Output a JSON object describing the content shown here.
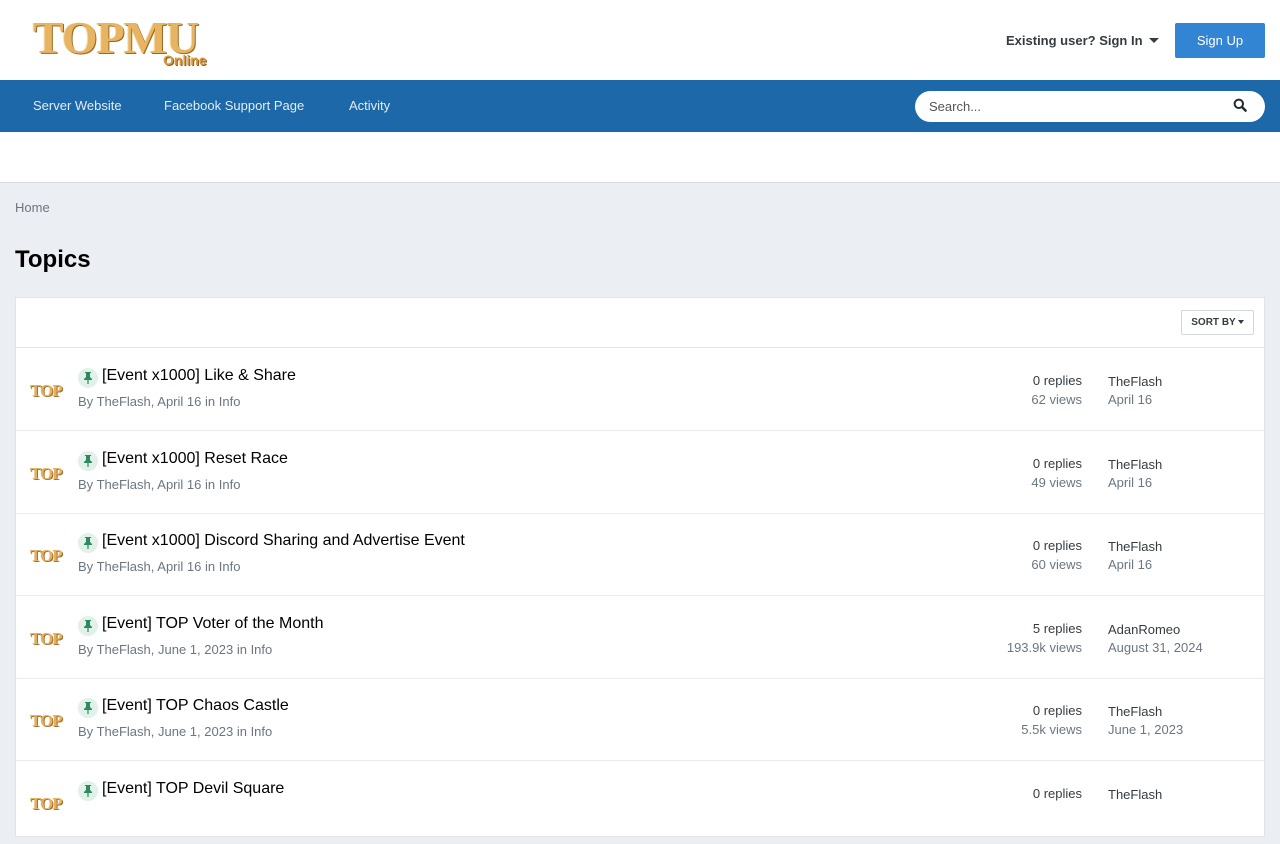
{
  "header": {
    "logo_text": "TOPMU",
    "logo_subtext": "Online",
    "signin_label": "Existing user? Sign In",
    "signup_label": "Sign Up"
  },
  "nav": {
    "items": [
      {
        "label": "Server Website"
      },
      {
        "label": "Facebook Support Page"
      },
      {
        "label": "Activity"
      }
    ],
    "search_placeholder": "Search..."
  },
  "breadcrumb": "Home",
  "page_title": "Topics",
  "sort_label": "SORT BY",
  "topics": [
    {
      "title": "[Event x1000] Like & Share",
      "author": "TheFlash",
      "date": "April 16",
      "forum": "Info",
      "replies": "0 replies",
      "views": "62 views",
      "last_user": "TheFlash",
      "last_date": "April 16"
    },
    {
      "title": "[Event x1000] Reset Race",
      "author": "TheFlash",
      "date": "April 16",
      "forum": "Info",
      "replies": "0 replies",
      "views": "49 views",
      "last_user": "TheFlash",
      "last_date": "April 16"
    },
    {
      "title": "[Event x1000] Discord Sharing and Advertise Event",
      "author": "TheFlash",
      "date": "April 16",
      "forum": "Info",
      "replies": "0 replies",
      "views": "60 views",
      "last_user": "TheFlash",
      "last_date": "April 16"
    },
    {
      "title": "[Event] TOP Voter of the Month",
      "author": "TheFlash",
      "date": "June 1, 2023",
      "forum": "Info",
      "replies": "5 replies",
      "views": "193.9k views",
      "last_user": "AdanRomeo",
      "last_date": "August 31, 2024"
    },
    {
      "title": "[Event] TOP Chaos Castle",
      "author": "TheFlash",
      "date": "June 1, 2023",
      "forum": "Info",
      "replies": "0 replies",
      "views": "5.5k views",
      "last_user": "TheFlash",
      "last_date": "June 1, 2023"
    },
    {
      "title": "[Event] TOP Devil Square",
      "author": "",
      "date": "",
      "forum": "",
      "replies": "0 replies",
      "views": "",
      "last_user": "TheFlash",
      "last_date": ""
    }
  ],
  "avatar_text": "TOP",
  "by_label": "By",
  "in_label": "in",
  "colors": {
    "nav_bg": "#1c68a8",
    "signup_bg": "#3285d3",
    "page_bg": "#ebeef2",
    "pin_bg": "#e2f0ea",
    "pin_icon": "#2b8a5e"
  }
}
